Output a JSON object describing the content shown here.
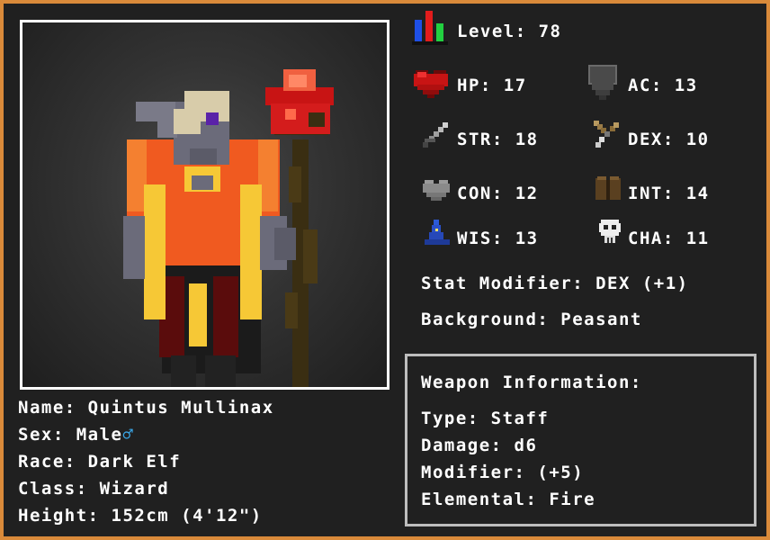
{
  "character": {
    "name_line": "Name: Quintus Mullinax",
    "sex_label": "Sex: Male",
    "sex_symbol": "♂",
    "race_line": "Race: Dark Elf",
    "class_line": "Class: Wizard",
    "height_line": "Height: 152cm (4'12\")"
  },
  "stats": {
    "level": "Level: 78",
    "hp": "HP: 17",
    "ac": "AC: 13",
    "str": "STR: 18",
    "dex": "DEX: 10",
    "con": "CON: 12",
    "int": "INT: 14",
    "wis": "WIS: 13",
    "cha": "CHA: 11",
    "stat_modifier": "Stat Modifier: DEX (+1)",
    "background": "Background: Peasant"
  },
  "weapon": {
    "title": "Weapon Information:",
    "type": "Type: Staff",
    "damage": "Damage: d6",
    "modifier": "Modifier: (+5)",
    "elemental": "Elemental: Fire"
  },
  "icons": {
    "level": "bar-chart-icon",
    "hp": "heart-icon",
    "ac": "shield-icon",
    "str": "sword-icon",
    "dex": "bow-icon",
    "con": "grey-heart-icon",
    "int": "book-icon",
    "wis": "wizard-hat-icon",
    "cha": "skull-icon"
  },
  "colors": {
    "frame": "#d98a3a",
    "background": "#202020",
    "text": "#ffffff",
    "male_symbol": "#3aa7e8"
  }
}
